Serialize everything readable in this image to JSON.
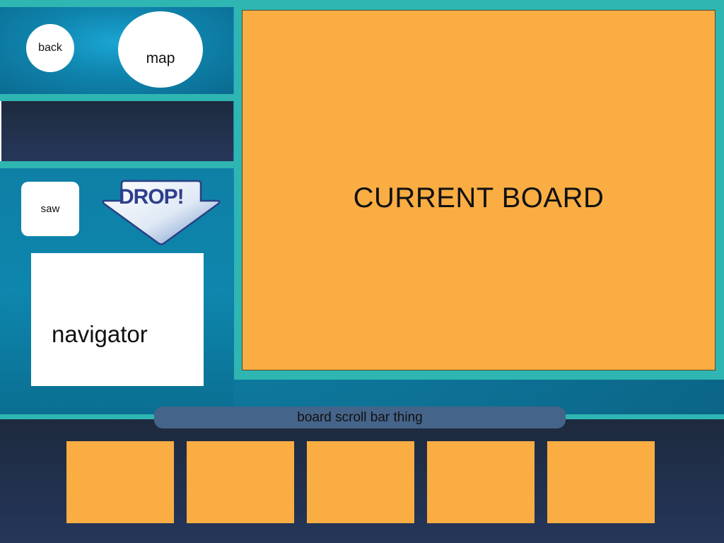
{
  "left_panel": {
    "back_label": "back",
    "map_label": "map",
    "saw_label": "saw",
    "drop_label": "DROP!",
    "navigator_label": "navigator"
  },
  "board": {
    "label": "CURRENT BOARD"
  },
  "scroll_bar": {
    "label": "board scroll bar thing"
  },
  "thumbnails": [
    {
      "name": "board-thumbnail-1"
    },
    {
      "name": "board-thumbnail-2"
    },
    {
      "name": "board-thumbnail-3"
    },
    {
      "name": "board-thumbnail-4"
    },
    {
      "name": "board-thumbnail-5"
    }
  ],
  "colors": {
    "board": "#f9ad43",
    "frame": "#2fb6b2",
    "drop_text": "#2f3e8c",
    "scroll_bar": "#456489"
  },
  "icons": {
    "drop": "down-arrow-icon"
  }
}
